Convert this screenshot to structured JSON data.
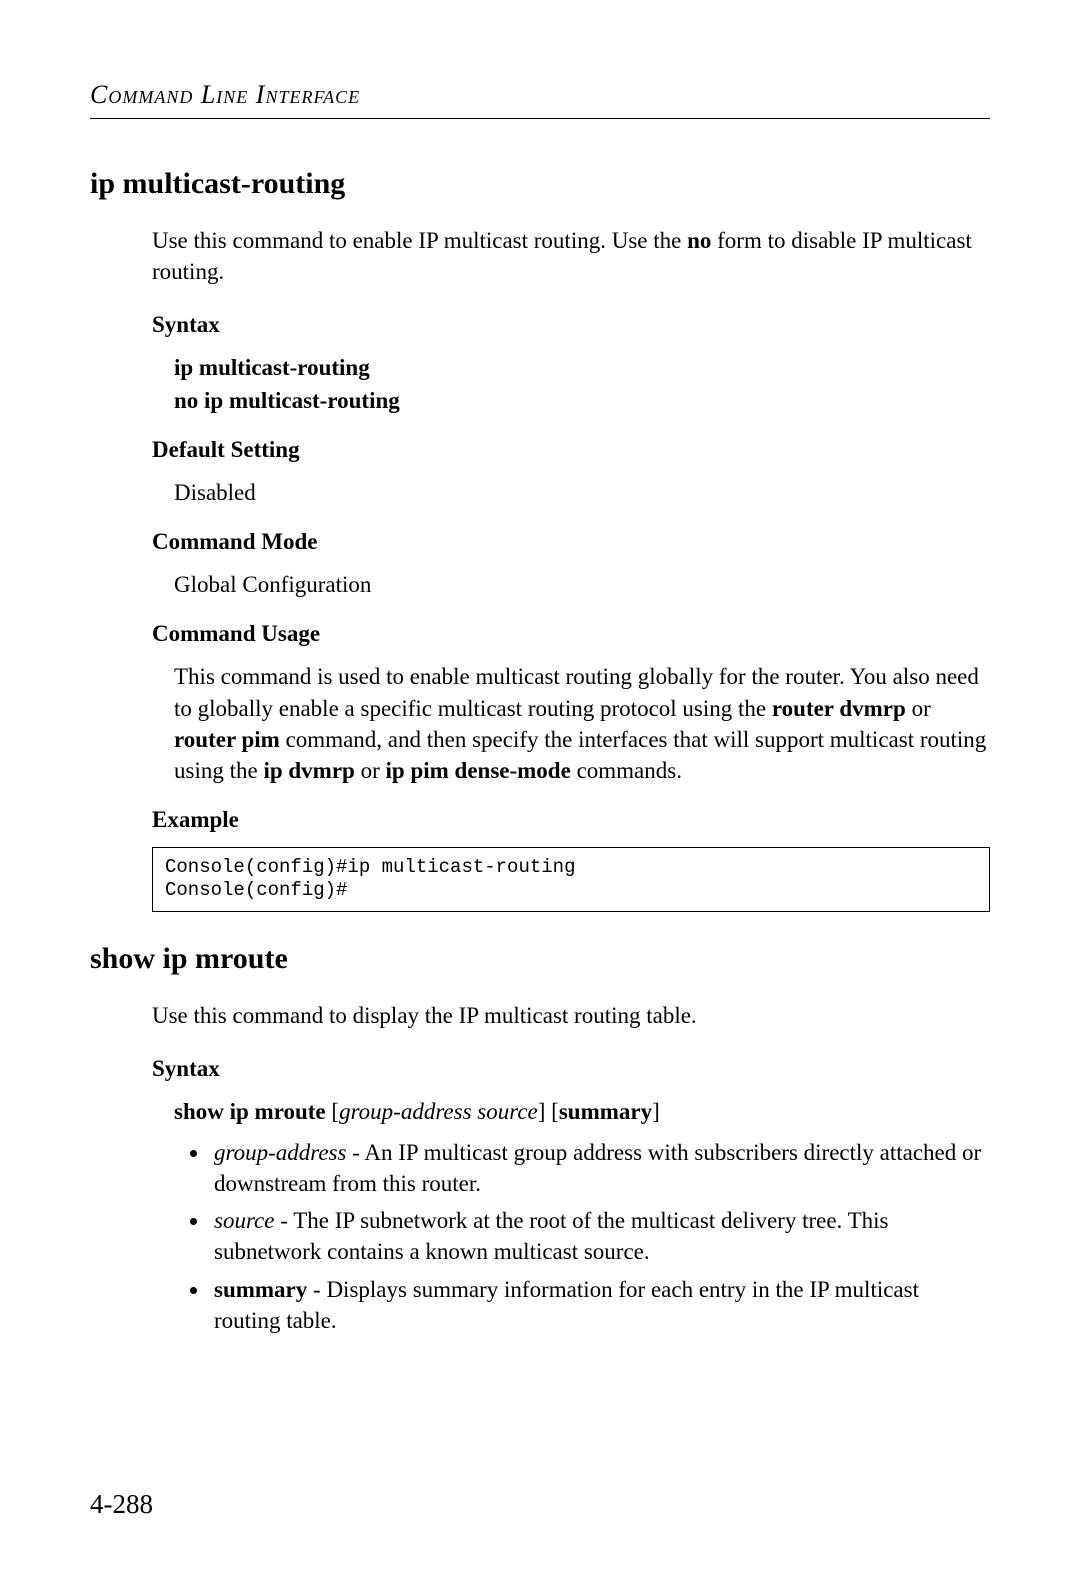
{
  "header": "Command Line Interface",
  "section1": {
    "title": "ip multicast-routing",
    "intro_pre": "Use this command to enable IP multicast routing. Use the ",
    "intro_bold": "no",
    "intro_post": " form to disable IP multicast routing.",
    "syntax_label": "Syntax",
    "syntax_line1": "ip multicast-routing",
    "syntax_line2": "no ip multicast-routing",
    "default_label": "Default Setting",
    "default_value": "Disabled",
    "mode_label": "Command Mode",
    "mode_value": "Global Configuration",
    "usage_label": "Command Usage",
    "usage_text_1": "This command is used to enable multicast routing globally for the router. You also need to globally enable a specific multicast routing protocol using the ",
    "usage_bold_1": "router dvmrp",
    "usage_text_2": " or ",
    "usage_bold_2": "router pim",
    "usage_text_3": " command, and then specify the interfaces that will support multicast routing using the ",
    "usage_bold_3": "ip dvmrp",
    "usage_text_4": " or ",
    "usage_bold_4": "ip pim dense-mode",
    "usage_text_5": " commands.",
    "example_label": "Example",
    "code": "Console(config)#ip multicast-routing\nConsole(config)#"
  },
  "section2": {
    "title": "show ip mroute",
    "intro": "Use this command to display the IP multicast routing table.",
    "syntax_label": "Syntax",
    "syntax_cmd": "show ip mroute",
    "syntax_arg1": "group-address source",
    "syntax_arg2": "summary",
    "bullet1_term": "group-address",
    "bullet1_text": " - An IP multicast group address with subscribers directly attached or downstream from this router.",
    "bullet2_term": "source",
    "bullet2_text": " - The IP subnetwork at the root of the multicast delivery tree. This subnetwork contains a known multicast source.",
    "bullet3_term": "summary",
    "bullet3_text": " - Displays summary information for each entry in the IP multicast routing table."
  },
  "page_number": "4-288"
}
